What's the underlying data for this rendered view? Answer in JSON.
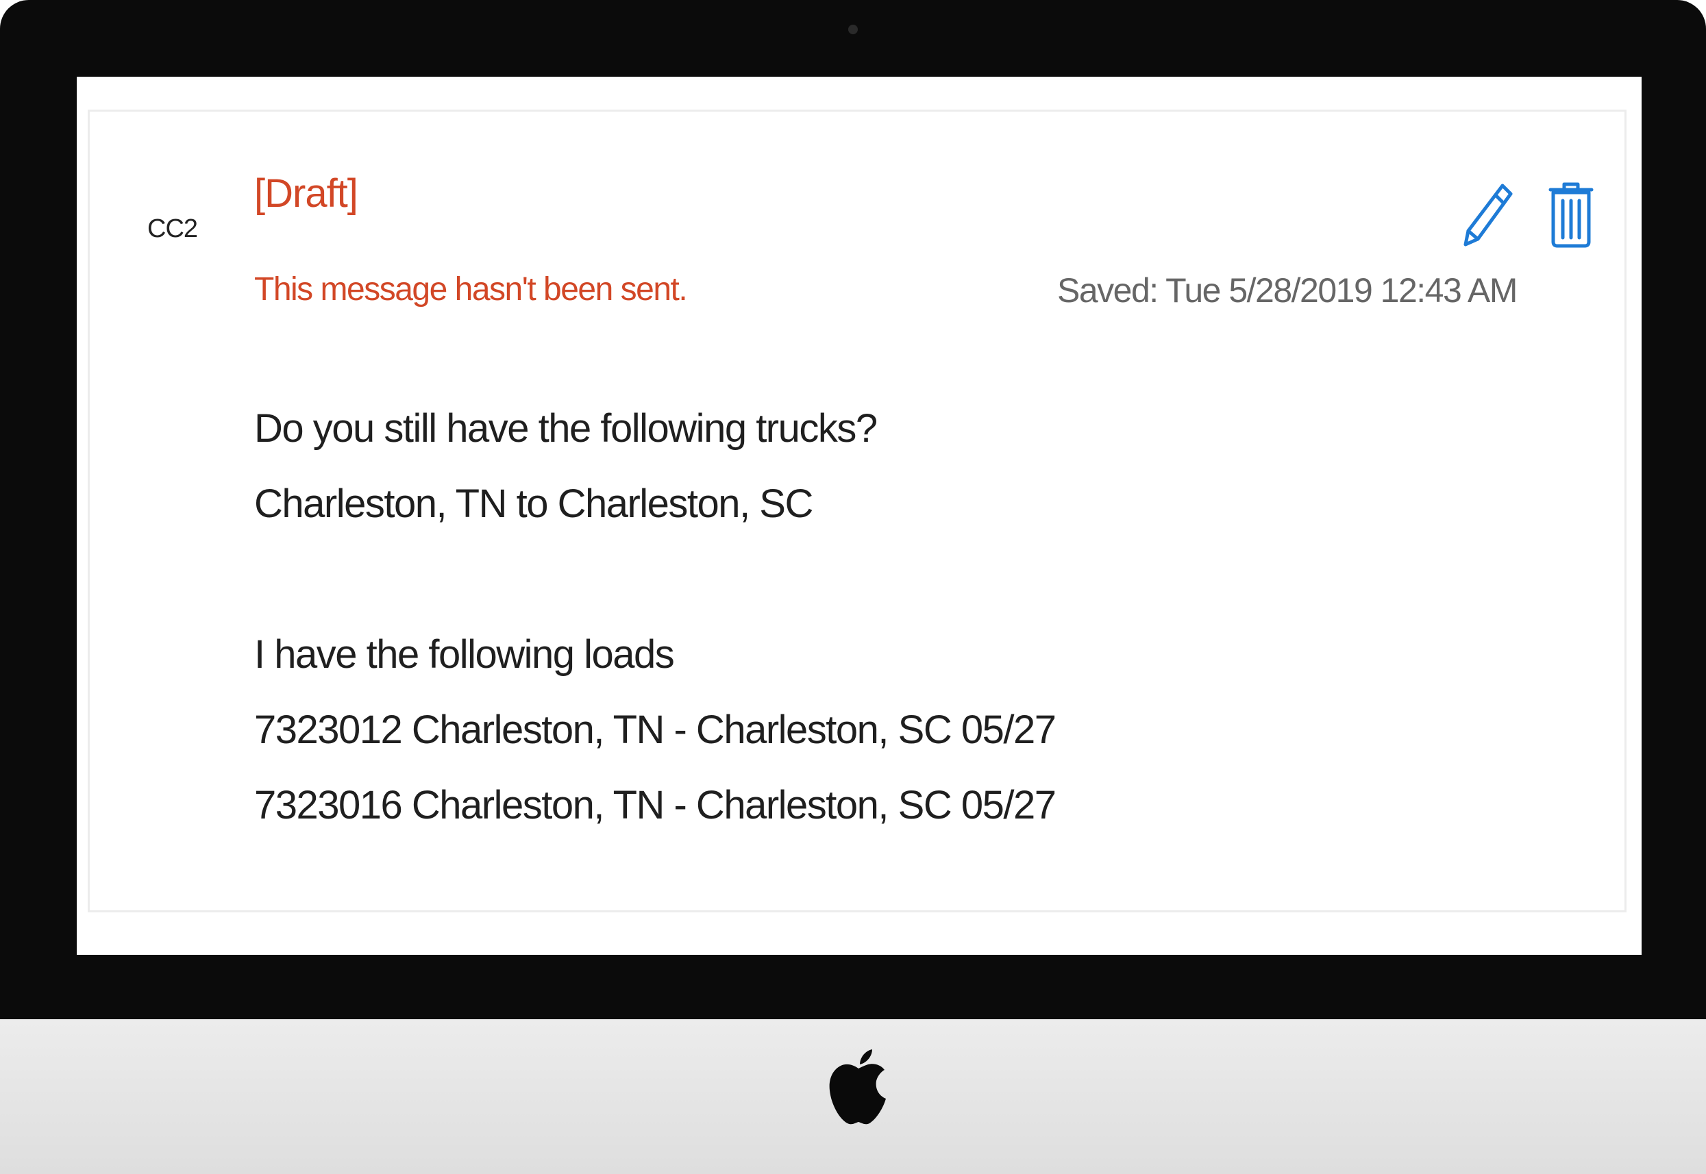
{
  "message": {
    "sender_initials": "CC2",
    "draft_tag": "[Draft]",
    "draft_notice": "This message hasn't been sent.",
    "saved_timestamp": "Saved: Tue 5/28/2019 12:43 AM",
    "body_lines": [
      "Do you still have the following trucks?",
      "Charleston, TN to Charleston, SC",
      "",
      "I have the following loads",
      "7323012 Charleston, TN - Charleston, SC 05/27",
      "7323016 Charleston, TN - Charleston, SC 05/27"
    ]
  },
  "actions": {
    "edit_icon": "pencil-icon",
    "delete_icon": "trash-icon"
  },
  "colors": {
    "draft_accent": "#d24726",
    "icon_blue": "#1e7bd6",
    "saved_text": "#666666"
  }
}
